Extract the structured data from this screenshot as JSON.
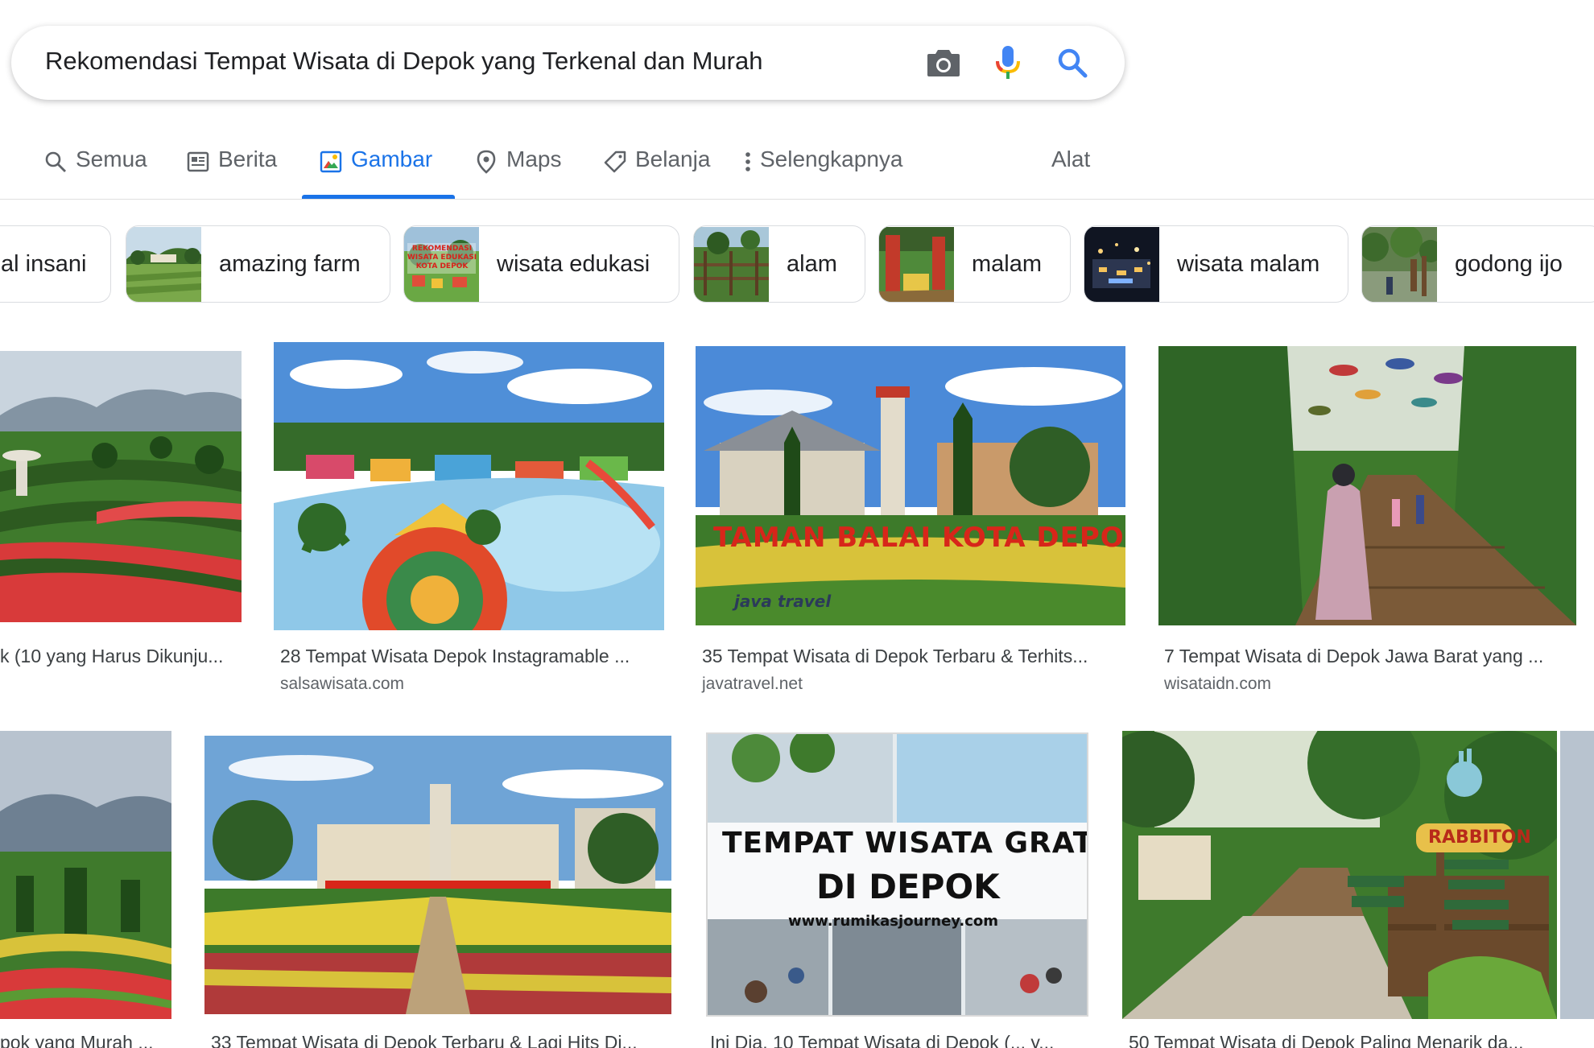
{
  "search": {
    "query": "Rekomendasi Tempat Wisata di Depok yang Terkenal dan Murah",
    "camera_icon": "camera-icon",
    "mic_icon": "microphone-icon",
    "search_icon": "search-icon"
  },
  "tabs": [
    {
      "label": "Semua",
      "icon": "search-icon"
    },
    {
      "label": "Berita",
      "icon": "news-icon"
    },
    {
      "label": "Gambar",
      "icon": "image-icon",
      "active": true
    },
    {
      "label": "Maps",
      "icon": "map-pin-icon"
    },
    {
      "label": "Belanja",
      "icon": "tag-icon"
    },
    {
      "label": "Selengkapnya",
      "icon": "more-vert-icon"
    }
  ],
  "tools_label": "Alat",
  "chips": [
    {
      "label": "al insani"
    },
    {
      "label": "amazing farm"
    },
    {
      "label": "wisata edukasi",
      "thumb_text": "REKOMENDASI WISATA EDUKASI KOTA DEPOK"
    },
    {
      "label": "alam"
    },
    {
      "label": "malam"
    },
    {
      "label": "wisata malam"
    },
    {
      "label": "godong ijo"
    }
  ],
  "results_row1": [
    {
      "title": "k (10 yang Harus Dikunju...",
      "source": ""
    },
    {
      "title": "28 Tempat Wisata Depok Instagramable ...",
      "source": "salsawisata.com"
    },
    {
      "title": "35 Tempat Wisata di Depok Terbaru & Terhits...",
      "source": "javatravel.net",
      "overlay": "TAMAN BALAI KOTA DEPOK",
      "watermark": "java travel"
    },
    {
      "title": "7 Tempat Wisata di Depok Jawa Barat yang ...",
      "source": "wisataidn.com"
    }
  ],
  "results_row2": [
    {
      "title": "pok yang Murah ..."
    },
    {
      "title": "33 Tempat Wisata di Depok Terbaru & Lagi Hits Di..."
    },
    {
      "title": "Ini Dia, 10 Tempat Wisata di Depok (... y...",
      "overlay_line1": "TEMPAT WISATA GRATIS",
      "overlay_line2": "DI DEPOK",
      "overlay_url": "www.rumikasjourney.com"
    },
    {
      "title": "50 Tempat Wisata di Depok Paling Menarik da...",
      "sign": "RABBITON"
    }
  ],
  "colors": {
    "accent": "#1a73e8",
    "text": "#202124",
    "muted": "#5f6368",
    "border": "#dadce0"
  }
}
